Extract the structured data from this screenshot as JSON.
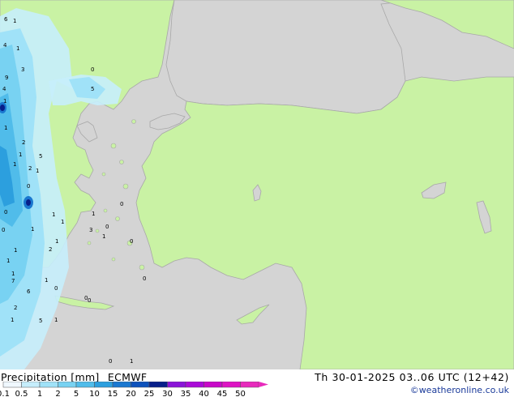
{
  "map": {
    "colors": {
      "sea": "#d4d4d4",
      "land": "#c9f2a4",
      "coast": "#a8a8a8"
    },
    "value_labels": [
      "6",
      "1",
      "4",
      "1",
      "9",
      "3",
      "4",
      "1",
      "1",
      "2",
      "1",
      "1",
      "2",
      "5",
      "0",
      "1",
      "1",
      "1",
      "2",
      "7",
      "1",
      "0",
      "5",
      "1",
      "6",
      "2",
      "1",
      "1",
      "0",
      "0",
      "1",
      "1",
      "1",
      "3",
      "1",
      "0",
      "0",
      "0",
      "0",
      "0",
      "1",
      "0",
      "0",
      "1",
      "1",
      "5",
      "0"
    ]
  },
  "footer": {
    "parameter": "Precipitation [mm]",
    "model": "ECMWF",
    "datetime": "Th 30-01-2025 03..06 UTC (12+42)",
    "credit": "©weatheronline.co.uk"
  },
  "legend": {
    "labels": [
      "0.1",
      "0.5",
      "1",
      "2",
      "5",
      "10",
      "15",
      "20",
      "25",
      "30",
      "35",
      "40",
      "45",
      "50"
    ],
    "colors": [
      "#f0f8ff",
      "#c6eefc",
      "#a0e2f8",
      "#78d2f2",
      "#50bcea",
      "#2c9fde",
      "#1a78d0",
      "#0d52bc",
      "#071f8a",
      "#8a14d8",
      "#aa0ad8",
      "#c808c8",
      "#de14c4",
      "#e82abc"
    ]
  }
}
